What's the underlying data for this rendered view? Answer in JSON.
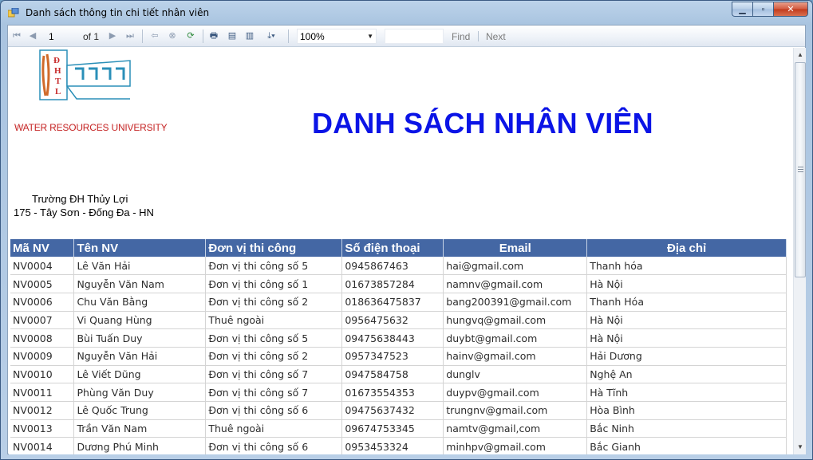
{
  "window": {
    "title": "Danh sách thông tin chi tiết nhân viên",
    "minimize_glyph": "▁",
    "maximize_glyph": "▫",
    "close_glyph": "✕"
  },
  "toolbar": {
    "page_number": "1",
    "page_of": "of 1",
    "zoom": "100%",
    "find_label": "Find",
    "next_label": "Next",
    "icons": [
      "first-page-icon",
      "previous-page-icon",
      "next-page-icon",
      "last-page-icon",
      "back-icon",
      "stop-icon",
      "refresh-icon",
      "print-icon",
      "print-layout-icon",
      "page-setup-icon",
      "export-icon"
    ]
  },
  "report": {
    "university_name": "WATER RESOURCES UNIVERSITY",
    "logo_letters": "ĐHTL",
    "title": "DANH SÁCH NHÂN VIÊN",
    "address_line1": "Trường ĐH Thủy Lợi",
    "address_line2": "175 - Tây Sơn - Đống Đa - HN",
    "columns": [
      "Mã NV",
      "Tên NV",
      "Đơn vị thi công",
      "Số điện thoại",
      "Email",
      "Địa chỉ"
    ],
    "rows": [
      {
        "ma": "NV0004",
        "ten": "Lê Văn Hải",
        "donvi": "Đơn vị thi công số 5",
        "sdt": "0945867463",
        "email": "hai@gmail.com",
        "diachi": "Thanh hóa"
      },
      {
        "ma": "NV0005",
        "ten": "Nguyễn Văn Nam",
        "donvi": "Đơn vị thi công số 1",
        "sdt": "01673857284",
        "email": "namnv@gmail.com",
        "diachi": "Hà Nội"
      },
      {
        "ma": "NV0006",
        "ten": "Chu Văn Bằng",
        "donvi": "Đơn vị thi công số 2",
        "sdt": "018636475837",
        "email": "bang200391@gmail.com",
        "diachi": "Thanh Hóa"
      },
      {
        "ma": "NV0007",
        "ten": "Vi Quang Hùng",
        "donvi": "Thuê ngoài",
        "sdt": "0956475632",
        "email": "hungvq@gmail.com",
        "diachi": "Hà Nội"
      },
      {
        "ma": "NV0008",
        "ten": "Bùi Tuấn Duy",
        "donvi": "Đơn vị thi công số 5",
        "sdt": "09475638443",
        "email": "duybt@gmail.com",
        "diachi": "Hà Nội"
      },
      {
        "ma": "NV0009",
        "ten": "Nguyễn Văn Hải",
        "donvi": "Đơn vị thi công số 2",
        "sdt": "0957347523",
        "email": "hainv@gmail.com",
        "diachi": "Hải Dương"
      },
      {
        "ma": "NV0010",
        "ten": "Lê Viết Dũng",
        "donvi": "Đơn vị thi công số 7",
        "sdt": "0947584758",
        "email": "dunglv",
        "diachi": "Nghệ An"
      },
      {
        "ma": "NV0011",
        "ten": "Phùng Văn Duy",
        "donvi": "Đơn vị thi công số 7",
        "sdt": "01673554353",
        "email": "duypv@gmail.com",
        "diachi": "Hà Tĩnh"
      },
      {
        "ma": "NV0012",
        "ten": "Lê Quốc Trung",
        "donvi": "Đơn vị thi công số 6",
        "sdt": "09475637432",
        "email": "trungnv@gmail.com",
        "diachi": "Hòa Bình"
      },
      {
        "ma": "NV0013",
        "ten": "Trần Văn Nam",
        "donvi": "Thuê ngoài",
        "sdt": "09674753345",
        "email": "namtv@gmail,com",
        "diachi": "Bắc Ninh"
      },
      {
        "ma": "NV0014",
        "ten": "Dương Phú Minh",
        "donvi": "Đơn vị thi công số 6",
        "sdt": "0953453324",
        "email": "minhpv@gmail.com",
        "diachi": "Bắc Gianh"
      }
    ]
  },
  "colors": {
    "title_blue": "#0b14e6",
    "header_bg": "#4467a4",
    "university_red": "#c72b2b"
  }
}
